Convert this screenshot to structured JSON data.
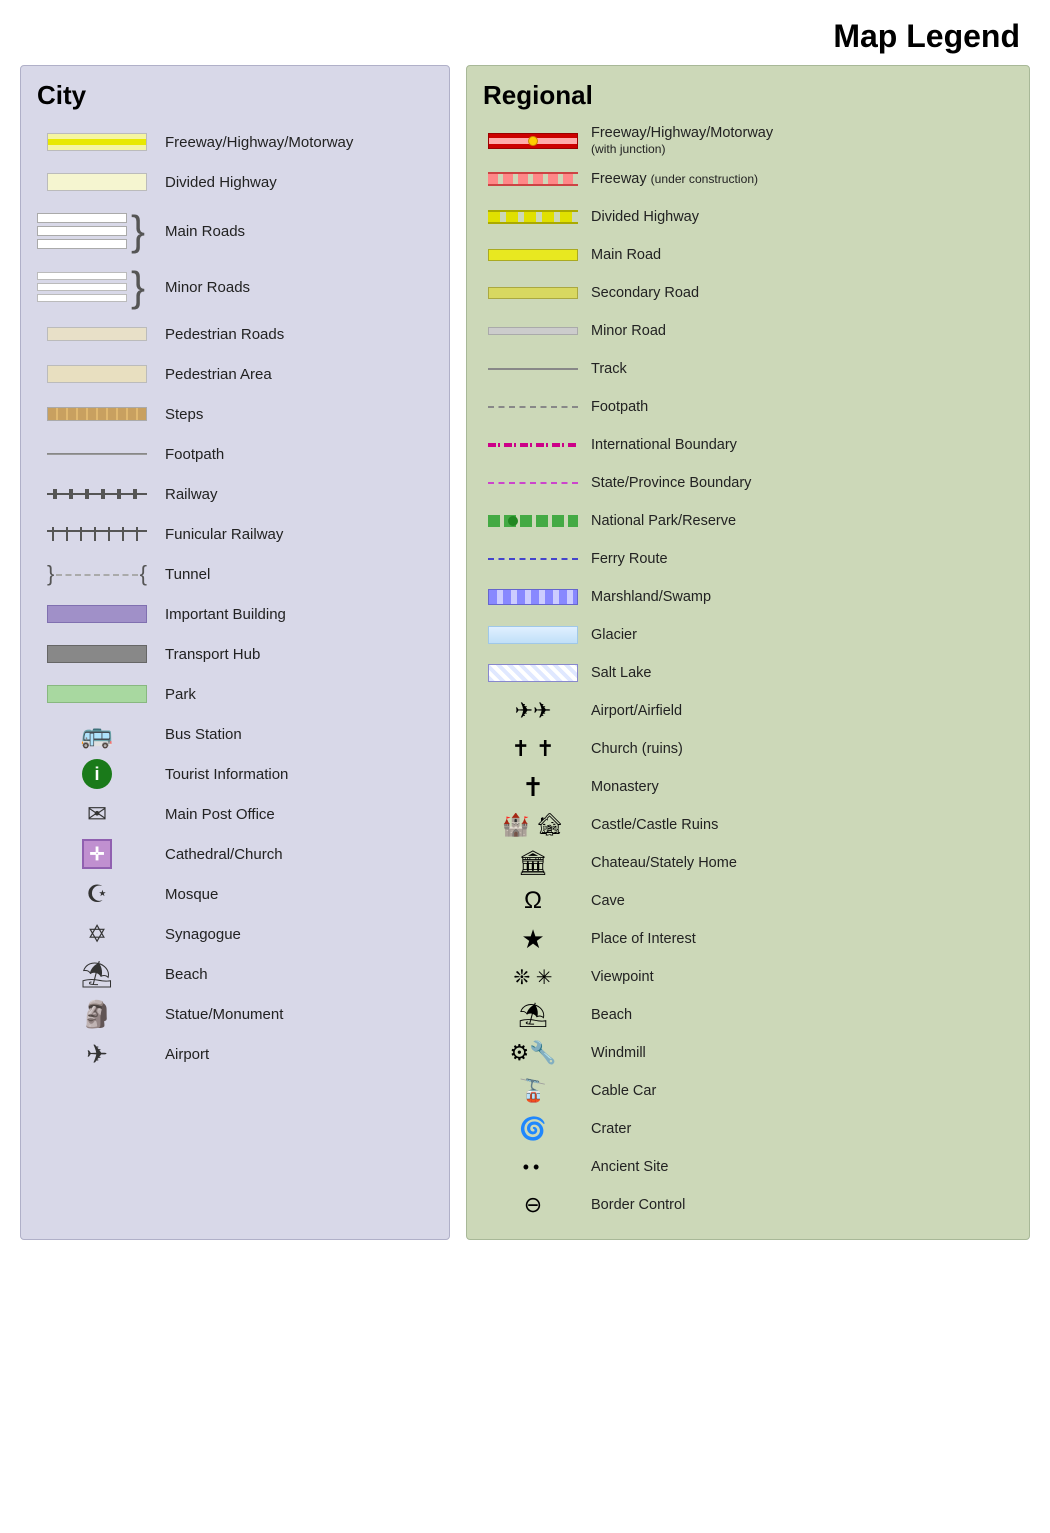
{
  "title": "Map Legend",
  "city": {
    "heading": "City",
    "items": [
      {
        "id": "city-freeway",
        "label": "Freeway/Highway/Motorway",
        "type": "freeway"
      },
      {
        "id": "city-divided",
        "label": "Divided Highway",
        "type": "divided"
      },
      {
        "id": "city-main-roads",
        "label": "Main Roads",
        "type": "main-roads"
      },
      {
        "id": "city-minor-roads",
        "label": "Minor Roads",
        "type": "minor-roads"
      },
      {
        "id": "city-pedestrian-roads",
        "label": "Pedestrian Roads",
        "type": "pedestrian-roads"
      },
      {
        "id": "city-pedestrian-area",
        "label": "Pedestrian Area",
        "type": "pedestrian-area"
      },
      {
        "id": "city-steps",
        "label": "Steps",
        "type": "steps"
      },
      {
        "id": "city-footpath",
        "label": "Footpath",
        "type": "footpath"
      },
      {
        "id": "city-railway",
        "label": "Railway",
        "type": "railway"
      },
      {
        "id": "city-funicular",
        "label": "Funicular Railway",
        "type": "funicular"
      },
      {
        "id": "city-tunnel",
        "label": "Tunnel",
        "type": "tunnel"
      },
      {
        "id": "city-important-building",
        "label": "Important Building",
        "type": "important-building"
      },
      {
        "id": "city-transport-hub",
        "label": "Transport Hub",
        "type": "transport-hub"
      },
      {
        "id": "city-park",
        "label": "Park",
        "type": "park"
      },
      {
        "id": "city-bus-station",
        "label": "Bus Station",
        "type": "bus-station"
      },
      {
        "id": "city-tourist-info",
        "label": "Tourist Information",
        "type": "tourist-info"
      },
      {
        "id": "city-post-office",
        "label": "Main Post Office",
        "type": "post-office"
      },
      {
        "id": "city-cathedral",
        "label": "Cathedral/Church",
        "type": "cathedral"
      },
      {
        "id": "city-mosque",
        "label": "Mosque",
        "type": "mosque"
      },
      {
        "id": "city-synagogue",
        "label": "Synagogue",
        "type": "synagogue"
      },
      {
        "id": "city-beach",
        "label": "Beach",
        "type": "beach"
      },
      {
        "id": "city-statue",
        "label": "Statue/Monument",
        "type": "statue"
      },
      {
        "id": "city-airport",
        "label": "Airport",
        "type": "airport"
      }
    ]
  },
  "regional": {
    "heading": "Regional",
    "items": [
      {
        "id": "reg-freeway",
        "label": "Freeway/Highway/Motorway",
        "sublabel": "(with junction)",
        "type": "reg-freeway"
      },
      {
        "id": "reg-freeway-uc",
        "label": "Freeway",
        "sublabel": "(under construction)",
        "type": "reg-freeway-uc"
      },
      {
        "id": "reg-divided",
        "label": "Divided Highway",
        "type": "reg-divided"
      },
      {
        "id": "reg-main-road",
        "label": "Main Road",
        "type": "reg-main-road"
      },
      {
        "id": "reg-secondary-road",
        "label": "Secondary Road",
        "type": "reg-secondary-road"
      },
      {
        "id": "reg-minor-road",
        "label": "Minor Road",
        "type": "reg-minor-road"
      },
      {
        "id": "reg-track",
        "label": "Track",
        "type": "reg-track"
      },
      {
        "id": "reg-footpath",
        "label": "Footpath",
        "type": "reg-footpath"
      },
      {
        "id": "reg-int-boundary",
        "label": "International Boundary",
        "type": "reg-int-boundary"
      },
      {
        "id": "reg-state-boundary",
        "label": "State/Province Boundary",
        "type": "reg-state-boundary"
      },
      {
        "id": "reg-national-park",
        "label": "National Park/Reserve",
        "type": "reg-national-park"
      },
      {
        "id": "reg-ferry",
        "label": "Ferry Route",
        "type": "reg-ferry"
      },
      {
        "id": "reg-marshland",
        "label": "Marshland/Swamp",
        "type": "reg-marshland"
      },
      {
        "id": "reg-glacier",
        "label": "Glacier",
        "type": "reg-glacier"
      },
      {
        "id": "reg-salt-lake",
        "label": "Salt Lake",
        "type": "reg-salt-lake"
      },
      {
        "id": "reg-airport",
        "label": "Airport/Airfield",
        "type": "reg-airport"
      },
      {
        "id": "reg-church",
        "label": "Church (ruins)",
        "type": "reg-church"
      },
      {
        "id": "reg-monastery",
        "label": "Monastery",
        "type": "reg-monastery"
      },
      {
        "id": "reg-castle",
        "label": "Castle/Castle Ruins",
        "type": "reg-castle"
      },
      {
        "id": "reg-chateau",
        "label": "Chateau/Stately Home",
        "type": "reg-chateau"
      },
      {
        "id": "reg-cave",
        "label": "Cave",
        "type": "reg-cave"
      },
      {
        "id": "reg-place-interest",
        "label": "Place of Interest",
        "type": "reg-place-interest"
      },
      {
        "id": "reg-viewpoint",
        "label": "Viewpoint",
        "type": "reg-viewpoint"
      },
      {
        "id": "reg-beach",
        "label": "Beach",
        "type": "reg-beach"
      },
      {
        "id": "reg-windmill",
        "label": "Windmill",
        "type": "reg-windmill"
      },
      {
        "id": "reg-cable-car",
        "label": "Cable Car",
        "type": "reg-cable-car"
      },
      {
        "id": "reg-crater",
        "label": "Crater",
        "type": "reg-crater"
      },
      {
        "id": "reg-ancient-site",
        "label": "Ancient Site",
        "type": "reg-ancient-site"
      },
      {
        "id": "reg-border-control",
        "label": "Border Control",
        "type": "reg-border-control"
      }
    ]
  }
}
